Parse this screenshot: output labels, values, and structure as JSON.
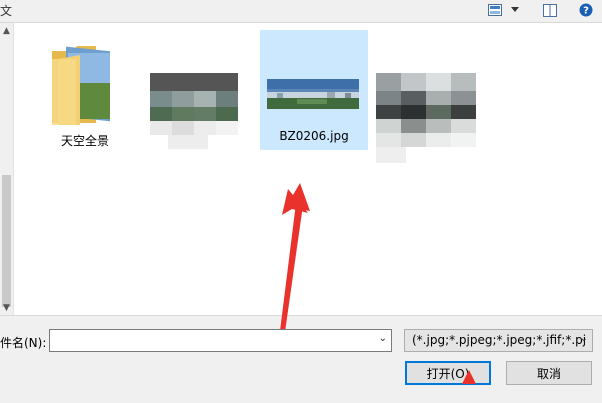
{
  "toolbar": {
    "cut_text": "文",
    "view_icon": "view-options-icon",
    "dropdown_icon": "chevron-down-icon",
    "preview_icon": "preview-pane-icon",
    "help_icon": "help-icon",
    "help_label": "?"
  },
  "files": [
    {
      "label": "天空全景",
      "type": "folder"
    },
    {
      "label": "",
      "type": "image-blurred"
    },
    {
      "label": "BZ0206.jpg",
      "type": "image",
      "selected": true
    },
    {
      "label": "",
      "type": "image-blurred"
    }
  ],
  "bottom": {
    "filename_label": "件名(N):",
    "filename_value": "",
    "filetype_value": "(*.jpg;*.pjpeg;*.jpeg;*.jfif;*.pj",
    "open_label": "打开(O)",
    "cancel_label": "取消"
  },
  "colors": {
    "selection": "#cce8ff",
    "accent": "#0078d7",
    "annotation_arrow": "#e8322b",
    "help_blue": "#1a5fb4"
  }
}
